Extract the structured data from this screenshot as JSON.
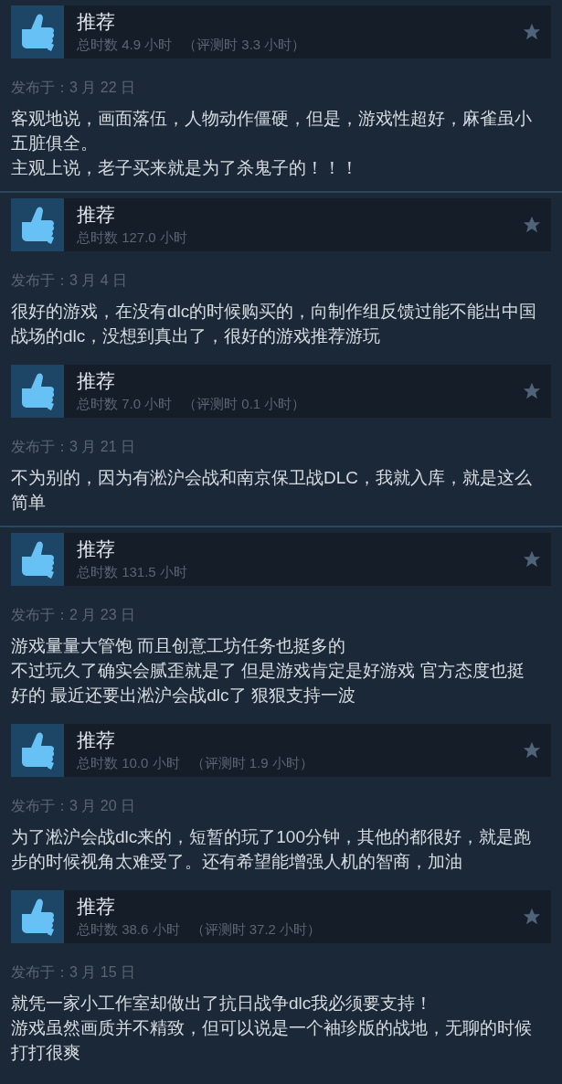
{
  "reviews": [
    {
      "verdict": "推荐",
      "hours": "总时数 4.9 小时",
      "review_hours": "（评测时 3.3 小时）",
      "date": "发布于：3 月 22 日",
      "paragraphs": [
        "客观地说，画面落伍，人物动作僵硬，但是，游戏性超好，麻雀虽小五脏俱全。",
        "主观上说，老子买来就是为了杀鬼子的！！！"
      ],
      "divider": true
    },
    {
      "verdict": "推荐",
      "hours": "总时数 127.0 小时",
      "date": "发布于：3 月 4 日",
      "paragraphs": [
        "很好的游戏，在没有dlc的时候购买的，向制作组反馈过能不能出中国战场的dlc，没想到真出了，很好的游戏推荐游玩"
      ],
      "divider": false
    },
    {
      "verdict": "推荐",
      "hours": "总时数 7.0 小时",
      "review_hours": "（评测时 0.1 小时）",
      "date": "发布于：3 月 21 日",
      "paragraphs": [
        "不为别的，因为有淞沪会战和南京保卫战DLC，我就入库，就是这么简单"
      ],
      "divider": true
    },
    {
      "verdict": "推荐",
      "hours": "总时数 131.5 小时",
      "date": "发布于：2 月 23 日",
      "paragraphs": [
        "游戏量量大管饱 而且创意工坊任务也挺多的",
        "不过玩久了确实会腻歪就是了 但是游戏肯定是好游戏 官方态度也挺好的 最近还要出淞沪会战dlc了 狠狠支持一波"
      ],
      "divider": false
    },
    {
      "verdict": "推荐",
      "hours": "总时数 10.0 小时",
      "review_hours": "（评测时 1.9 小时）",
      "date": "发布于：3 月 20 日",
      "paragraphs": [
        "为了淞沪会战dlc来的，短暂的玩了100分钟，其他的都很好，就是跑步的时候视角太难受了。还有希望能增强人机的智商，加油"
      ],
      "divider": false
    },
    {
      "verdict": "推荐",
      "hours": "总时数 38.6 小时",
      "review_hours": "（评测时 37.2 小时）",
      "date": "发布于：3 月 15 日",
      "paragraphs": [
        "就凭一家小工作室却做出了抗日战争dlc我必须要支持！",
        "游戏虽然画质并不精致，但可以说是一个袖珍版的战地，无聊的时候打打很爽"
      ],
      "divider": false
    }
  ]
}
